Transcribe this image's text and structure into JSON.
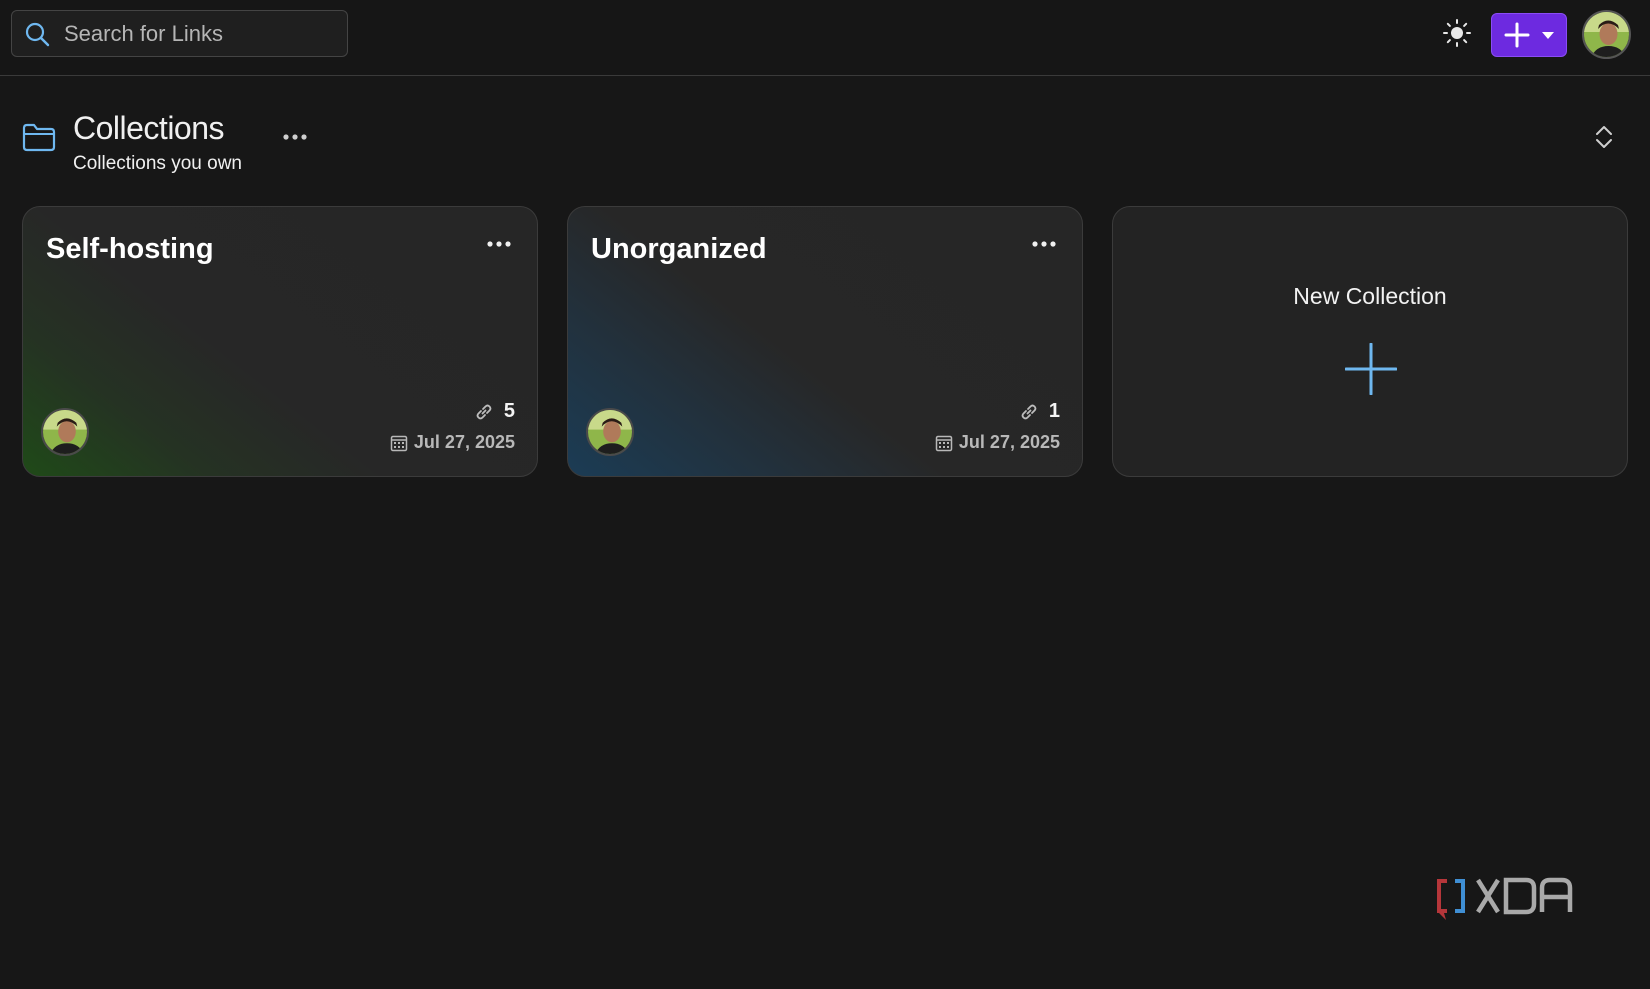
{
  "search": {
    "placeholder": "Search for Links",
    "icon": "search-icon"
  },
  "header_actions": {
    "theme_icon": "sun-icon",
    "add_button_icon": "plus-icon",
    "add_button_dropdown_icon": "caret-down-icon",
    "accent_color": "#6d2ae0"
  },
  "section": {
    "icon": "folder-icon",
    "title": "Collections",
    "subtitle": "Collections you own",
    "menu_icon": "ellipsis-icon",
    "sort_icon": "sort-toggle-icon"
  },
  "collections": [
    {
      "name": "Self-hosting",
      "link_count": "5",
      "date": "Jul 27, 2025",
      "accent": "#1f4a18"
    },
    {
      "name": "Unorganized",
      "link_count": "1",
      "date": "Jul 27, 2025",
      "accent": "#1b3c55"
    }
  ],
  "new_collection": {
    "label": "New Collection",
    "icon": "plus-icon",
    "icon_color": "#6fb8f0"
  },
  "watermark": {
    "brand": "XDA"
  }
}
